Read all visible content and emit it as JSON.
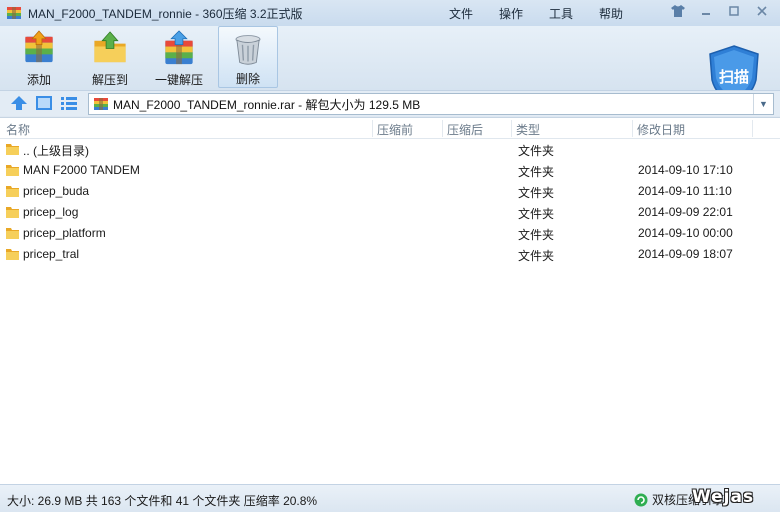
{
  "window": {
    "title": "MAN_F2000_TANDEM_ronnie - 360压缩 3.2正式版"
  },
  "menu": {
    "items": [
      {
        "label": "文件"
      },
      {
        "label": "操作"
      },
      {
        "label": "工具"
      },
      {
        "label": "帮助"
      }
    ]
  },
  "toolbar": {
    "add_label": "添加",
    "extract_to_label": "解压到",
    "one_click_label": "一键解压",
    "delete_label": "删除",
    "scan_label": "扫描"
  },
  "address": {
    "path": "MAN_F2000_TANDEM_ronnie.rar - 解包大小为 129.5 MB"
  },
  "columns": {
    "name": "名称",
    "before": "压缩前",
    "after": "压缩后",
    "type": "类型",
    "modified": "修改日期"
  },
  "files": [
    {
      "name": ".. (上级目录)",
      "type": "文件夹",
      "modified": ""
    },
    {
      "name": "MAN F2000 TANDEM",
      "type": "文件夹",
      "modified": "2014-09-10 17:10"
    },
    {
      "name": "pricep_buda",
      "type": "文件夹",
      "modified": "2014-09-10 11:10"
    },
    {
      "name": "pricep_log",
      "type": "文件夹",
      "modified": "2014-09-09 22:01"
    },
    {
      "name": "pricep_platform",
      "type": "文件夹",
      "modified": "2014-09-10 00:00"
    },
    {
      "name": "pricep_tral",
      "type": "文件夹",
      "modified": "2014-09-09 18:07"
    }
  ],
  "status": {
    "summary": "大小: 26.9 MB 共 163 个文件和 41 个文件夹 压缩率 20.8%",
    "engine": "双核压缩引擎",
    "watermark": "Wejas"
  },
  "colors": {
    "accent": "#2f7fd6",
    "folder": "#f2c23a"
  }
}
